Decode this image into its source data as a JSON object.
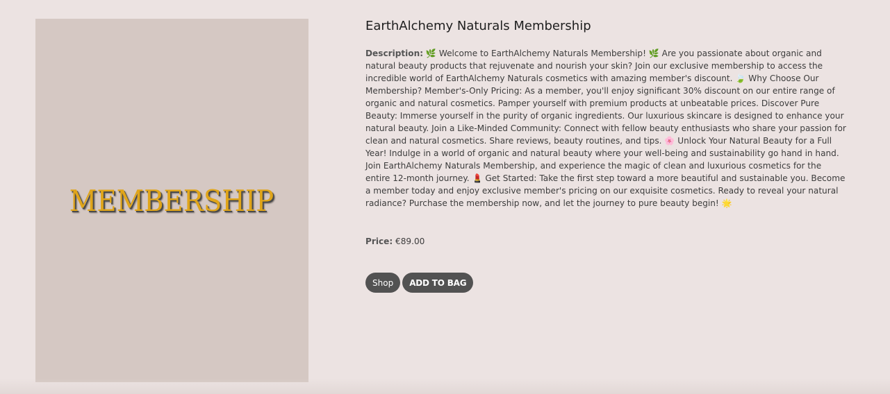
{
  "product": {
    "image": {
      "wordmark": "MEMBERSHIP",
      "background_color": "#d5c8c3",
      "text_color": "#e0a51a"
    },
    "title": "EarthAlchemy Naturals Membership",
    "description_label": "Description:",
    "description": "🌿 Welcome to EarthAlchemy Naturals Membership! 🌿 Are you passionate about organic and natural beauty products that rejuvenate and nourish your skin? Join our exclusive membership to access the incredible world of EarthAlchemy Naturals cosmetics with amazing member's discount. 🍃 Why Choose Our Membership? Member's-Only Pricing: As a member, you'll enjoy significant 30% discount on our entire range of organic and natural cosmetics. Pamper yourself with premium products at unbeatable prices. Discover Pure Beauty: Immerse yourself in the purity of organic ingredients. Our luxurious skincare is designed to enhance your natural beauty. Join a Like-Minded Community: Connect with fellow beauty enthusiasts who share your passion for clean and natural cosmetics. Share reviews, beauty routines, and tips. 🌸 Unlock Your Natural Beauty for a Full Year! Indulge in a world of organic and natural beauty where your well-being and sustainability go hand in hand. Join EarthAlchemy Naturals Membership, and experience the magic of clean and luxurious cosmetics for the entire 12-month journey. 💄 Get Started: Take the first step toward a more beautiful and sustainable you. Become a member today and enjoy exclusive member's pricing on our exquisite cosmetics. Ready to reveal your natural radiance? Purchase the membership now, and let the journey to pure beauty begin! 🌟",
    "price_label": "Price:",
    "price": "€89.00"
  },
  "actions": {
    "shop_label": "Shop",
    "add_to_bag_label": "ADD TO BAG"
  },
  "colors": {
    "page_background": "#ece3e2",
    "button_background": "#525252",
    "button_text": "#ffffff"
  }
}
